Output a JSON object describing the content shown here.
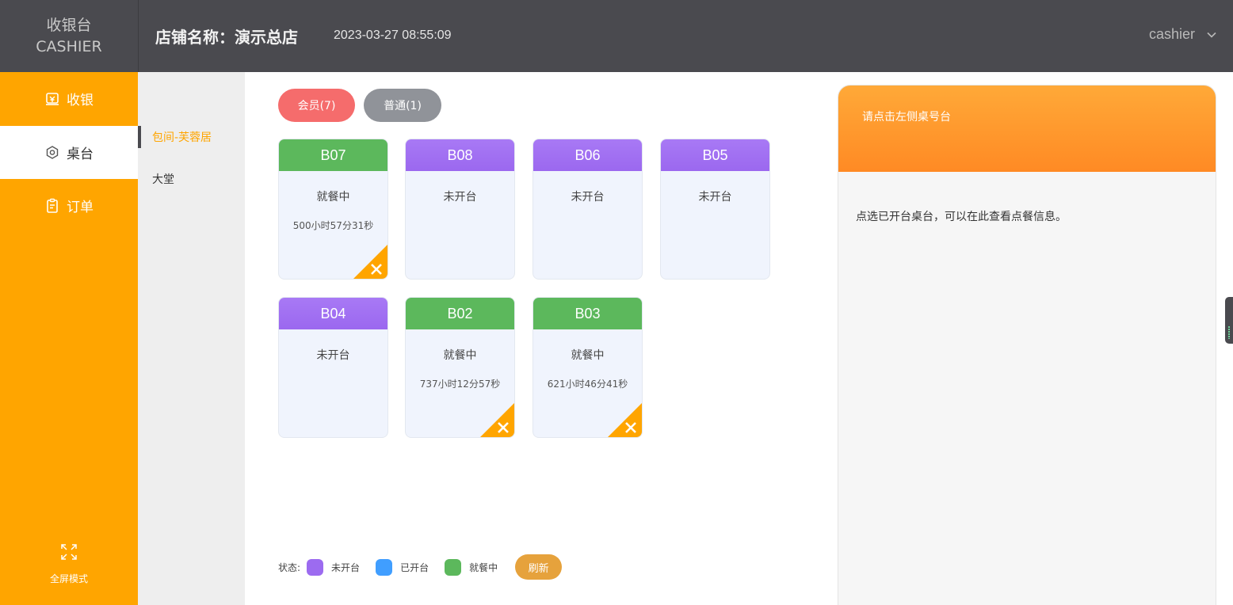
{
  "brand": {
    "line1": "收银台",
    "line2": "CASHIER"
  },
  "header": {
    "store_name": "店铺名称：演示总店",
    "datetime": "2023-03-27 08:55:09",
    "user": "cashier"
  },
  "sidebar": {
    "items": [
      {
        "label": "收银",
        "icon": "cash-register-icon",
        "active": false
      },
      {
        "label": "桌台",
        "icon": "table-gear-icon",
        "active": true
      },
      {
        "label": "订单",
        "icon": "clipboard-order-icon",
        "active": false
      }
    ],
    "fullscreen_label": "全屏模式"
  },
  "areas": [
    {
      "label": "包间-芙蓉居",
      "active": true
    },
    {
      "label": "大堂",
      "active": false
    }
  ],
  "filters": {
    "member": "会员(7)",
    "normal": "普通(1)"
  },
  "tables": [
    {
      "name": "B07",
      "status": "就餐中",
      "time": "500小时57分31秒",
      "state": "dining"
    },
    {
      "name": "B08",
      "status": "未开台",
      "time": "",
      "state": "closed"
    },
    {
      "name": "B06",
      "status": "未开台",
      "time": "",
      "state": "closed"
    },
    {
      "name": "B05",
      "status": "未开台",
      "time": "",
      "state": "closed"
    },
    {
      "name": "B04",
      "status": "未开台",
      "time": "",
      "state": "closed"
    },
    {
      "name": "B02",
      "status": "就餐中",
      "time": "737小时12分57秒",
      "state": "dining"
    },
    {
      "name": "B03",
      "status": "就餐中",
      "time": "621小时46分41秒",
      "state": "dining"
    }
  ],
  "legend": {
    "label": "状态:",
    "items": [
      {
        "label": "未开台",
        "color": "#9c6bf0"
      },
      {
        "label": "已开台",
        "color": "#409eff"
      },
      {
        "label": "就餐中",
        "color": "#5cb85c"
      }
    ],
    "refresh": "刷新"
  },
  "detail": {
    "header": "请点击左侧桌号台",
    "hint": "点选已开台桌台，可以在此查看点餐信息。"
  },
  "colors": {
    "accent": "#ffa500",
    "header_bg": "#4a4a4f",
    "dining": "#5cb85c",
    "closed": "#9c6bf0",
    "member_pill": "#f56c6c",
    "normal_pill": "#909399"
  }
}
